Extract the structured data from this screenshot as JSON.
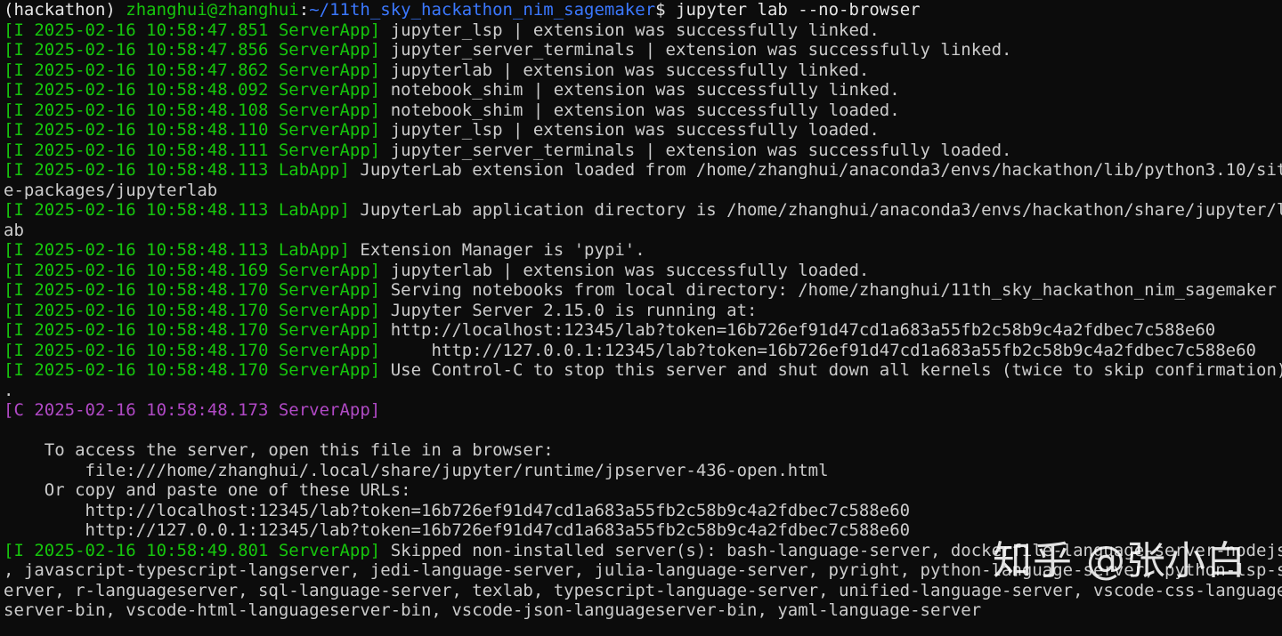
{
  "prompt": {
    "env": "(hackathon) ",
    "userhost": "zhanghui@zhanghui",
    "colon": ":",
    "path": "~/11th_sky_hackathon_nim_sagemaker",
    "dollar": "$ ",
    "command": "jupyter lab --no-browser"
  },
  "log": [
    {
      "prefix": "[I 2025-02-16 10:58:47.851 ServerApp]",
      "text": " jupyter_lsp | extension was successfully linked."
    },
    {
      "prefix": "[I 2025-02-16 10:58:47.856 ServerApp]",
      "text": " jupyter_server_terminals | extension was successfully linked."
    },
    {
      "prefix": "[I 2025-02-16 10:58:47.862 ServerApp]",
      "text": " jupyterlab | extension was successfully linked."
    },
    {
      "prefix": "[I 2025-02-16 10:58:48.092 ServerApp]",
      "text": " notebook_shim | extension was successfully linked."
    },
    {
      "prefix": "[I 2025-02-16 10:58:48.108 ServerApp]",
      "text": " notebook_shim | extension was successfully loaded."
    },
    {
      "prefix": "[I 2025-02-16 10:58:48.110 ServerApp]",
      "text": " jupyter_lsp | extension was successfully loaded."
    },
    {
      "prefix": "[I 2025-02-16 10:58:48.111 ServerApp]",
      "text": " jupyter_server_terminals | extension was successfully loaded."
    },
    {
      "prefix": "[I 2025-02-16 10:58:48.113 LabApp]",
      "text": " JupyterLab extension loaded from /home/zhanghui/anaconda3/envs/hackathon/lib/python3.10/sit"
    },
    {
      "prefix": "",
      "text": "e-packages/jupyterlab"
    },
    {
      "prefix": "[I 2025-02-16 10:58:48.113 LabApp]",
      "text": " JupyterLab application directory is /home/zhanghui/anaconda3/envs/hackathon/share/jupyter/l"
    },
    {
      "prefix": "",
      "text": "ab"
    },
    {
      "prefix": "[I 2025-02-16 10:58:48.113 LabApp]",
      "text": " Extension Manager is 'pypi'."
    },
    {
      "prefix": "[I 2025-02-16 10:58:48.169 ServerApp]",
      "text": " jupyterlab | extension was successfully loaded."
    },
    {
      "prefix": "[I 2025-02-16 10:58:48.170 ServerApp]",
      "text": " Serving notebooks from local directory: /home/zhanghui/11th_sky_hackathon_nim_sagemaker"
    },
    {
      "prefix": "[I 2025-02-16 10:58:48.170 ServerApp]",
      "text": " Jupyter Server 2.15.0 is running at:"
    },
    {
      "prefix": "[I 2025-02-16 10:58:48.170 ServerApp]",
      "text": " http://localhost:12345/lab?token=16b726ef91d47cd1a683a55fb2c58b9c4a2fdbec7c588e60"
    },
    {
      "prefix": "[I 2025-02-16 10:58:48.170 ServerApp]",
      "text": "     http://127.0.0.1:12345/lab?token=16b726ef91d47cd1a683a55fb2c58b9c4a2fdbec7c588e60"
    },
    {
      "prefix": "[I 2025-02-16 10:58:48.170 ServerApp]",
      "text": " Use Control-C to stop this server and shut down all kernels (twice to skip confirmation)"
    },
    {
      "prefix": "",
      "text": "."
    },
    {
      "prefix": "[C 2025-02-16 10:58:48.173 ServerApp]",
      "text": "",
      "critical": true
    },
    {
      "prefix": "",
      "text": ""
    },
    {
      "prefix": "",
      "text": "    To access the server, open this file in a browser:"
    },
    {
      "prefix": "",
      "text": "        file:///home/zhanghui/.local/share/jupyter/runtime/jpserver-436-open.html"
    },
    {
      "prefix": "",
      "text": "    Or copy and paste one of these URLs:"
    },
    {
      "prefix": "",
      "text": "        http://localhost:12345/lab?token=16b726ef91d47cd1a683a55fb2c58b9c4a2fdbec7c588e60"
    },
    {
      "prefix": "",
      "text": "        http://127.0.0.1:12345/lab?token=16b726ef91d47cd1a683a55fb2c58b9c4a2fdbec7c588e60"
    },
    {
      "prefix": "[I 2025-02-16 10:58:49.801 ServerApp]",
      "text": " Skipped non-installed server(s): bash-language-server, dockerfile-language-server-nodejs"
    },
    {
      "prefix": "",
      "text": ", javascript-typescript-langserver, jedi-language-server, julia-language-server, pyright, python-language-server, python-lsp-s"
    },
    {
      "prefix": "",
      "text": "erver, r-languageserver, sql-language-server, texlab, typescript-language-server, unified-language-server, vscode-css-language"
    },
    {
      "prefix": "",
      "text": "server-bin, vscode-html-languageserver-bin, vscode-json-languageserver-bin, yaml-language-server"
    }
  ],
  "watermark": "知乎 @张小白",
  "colors": {
    "background": "#0c0c0c",
    "text": "#cccccc",
    "info_prefix": "#16c60c",
    "critical_prefix": "#b148c6",
    "path": "#3b78ff"
  }
}
